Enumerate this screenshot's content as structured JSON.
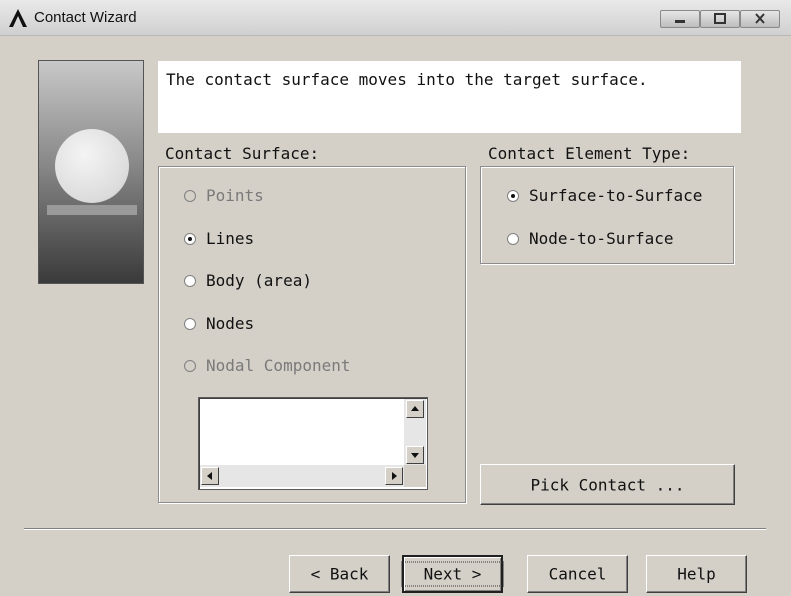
{
  "window": {
    "title": "Contact Wizard",
    "logo_icon": "ansys-logo-icon"
  },
  "message": "The contact surface moves into the target surface.",
  "contact_surface": {
    "label": "Contact Surface:",
    "options": [
      {
        "label": "Points",
        "checked": false,
        "enabled": false
      },
      {
        "label": "Lines",
        "checked": true,
        "enabled": true
      },
      {
        "label": "Body (area)",
        "checked": false,
        "enabled": true
      },
      {
        "label": "Nodes",
        "checked": false,
        "enabled": true
      },
      {
        "label": "Nodal Component",
        "checked": false,
        "enabled": false
      }
    ]
  },
  "contact_element_type": {
    "label": "Contact Element Type:",
    "options": [
      {
        "label": "Surface-to-Surface",
        "checked": true,
        "enabled": true
      },
      {
        "label": "Node-to-Surface",
        "checked": false,
        "enabled": true
      }
    ]
  },
  "buttons": {
    "pick_contact": "Pick Contact ...",
    "back": "< Back",
    "next": "Next >",
    "cancel": "Cancel",
    "help": "Help"
  },
  "colors": {
    "dialog_bg": "#d4d0c8",
    "message_bg": "#ffffff",
    "disabled_text": "#7a7a7a"
  }
}
